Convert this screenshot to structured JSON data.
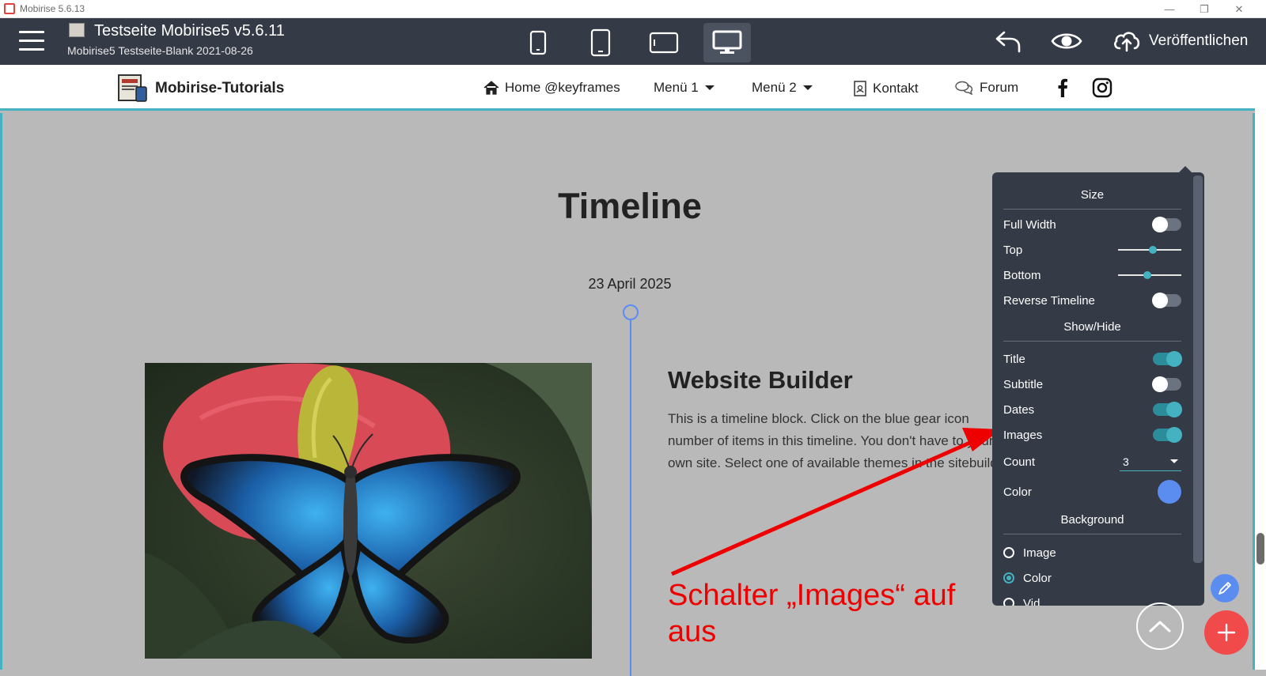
{
  "window": {
    "title": "Mobirise 5.6.13",
    "minimize": "—",
    "restore": "❐",
    "close": "✕"
  },
  "toolbar": {
    "project_title": "Testseite Mobirise5 v5.6.11",
    "project_subtitle": "Mobirise5 Testseite-Blank 2021-08-26",
    "devices": [
      "phone-portrait",
      "phone-large",
      "tablet-landscape",
      "desktop"
    ],
    "active_device": "desktop",
    "publish_label": "Veröffentlichen"
  },
  "site_nav": {
    "brand": "Mobirise-Tutorials",
    "items": [
      {
        "label": "Home @keyframes",
        "icon": "home-icon"
      },
      {
        "label": "Menü 1",
        "dropdown": true
      },
      {
        "label": "Menü 2",
        "dropdown": true
      },
      {
        "label": "Kontakt",
        "icon": "contact-card-icon"
      },
      {
        "label": "Forum",
        "icon": "chat-bubbles-icon"
      }
    ],
    "social": [
      "facebook-icon",
      "instagram-icon"
    ]
  },
  "timeline": {
    "title": "Timeline",
    "date": "23 April 2025",
    "item_title": "Website Builder",
    "item_text": "This is a timeline block. Click on the blue gear icon number of items in this timeline. You don't have to your own site. Select one of available themes in the sitebuilder."
  },
  "annotation": {
    "text": "Schalter „Images“ auf aus",
    "color": "#ee0000"
  },
  "settings": {
    "size_heading": "Size",
    "full_width_label": "Full Width",
    "full_width": false,
    "top_label": "Top",
    "top_value": 0.55,
    "bottom_label": "Bottom",
    "bottom_value": 0.45,
    "reverse_label": "Reverse Timeline",
    "reverse": false,
    "show_hide_heading": "Show/Hide",
    "title_label": "Title",
    "title_on": true,
    "subtitle_label": "Subtitle",
    "subtitle_on": false,
    "dates_label": "Dates",
    "dates_on": true,
    "images_label": "Images",
    "images_on": true,
    "count_label": "Count",
    "count_value": "3",
    "color_label": "Color",
    "color_value": "#5b8df0",
    "background_heading": "Background",
    "bg_options": [
      "Image",
      "Color",
      "Vid"
    ],
    "bg_selected": "Color"
  },
  "colors": {
    "accent": "#45b2c1",
    "toolbar": "#343a46",
    "fab_add": "#f04a4a",
    "fab_edit": "#5b8df0",
    "timeline": "#5b8df0"
  }
}
